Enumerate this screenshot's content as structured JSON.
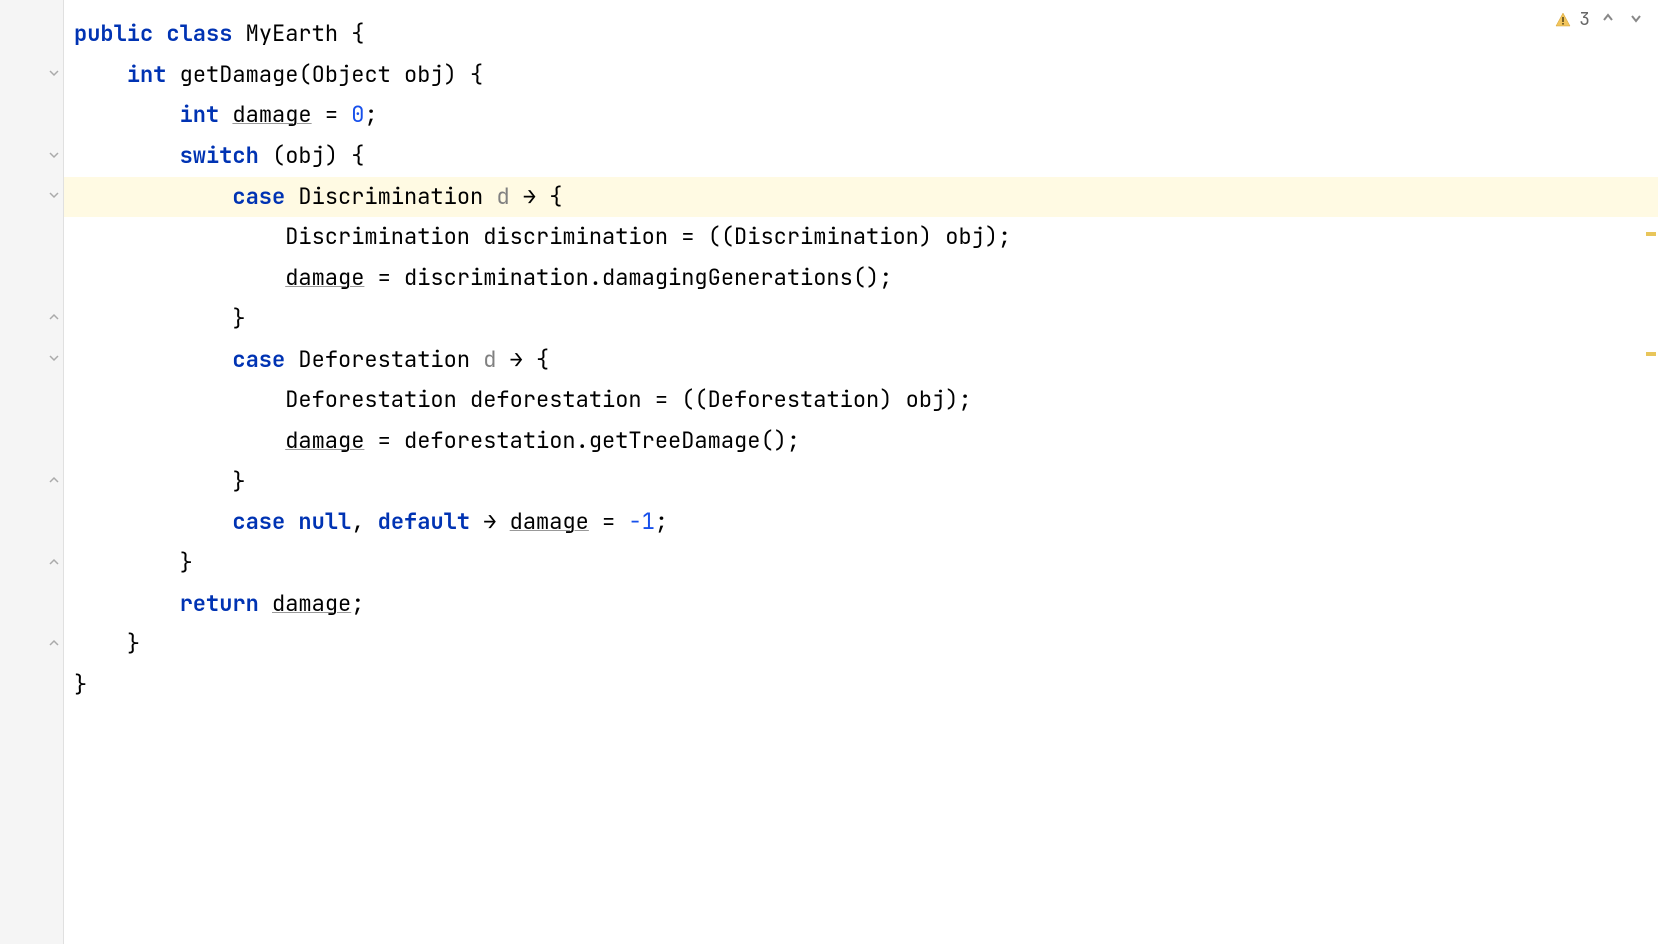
{
  "inspection": {
    "warning_count": "3"
  },
  "code": {
    "line1": {
      "kw_public": "public",
      "kw_class": "class",
      "classname": "MyEarth",
      "brace": " {"
    },
    "line2": {
      "kw_int": "int",
      "method": "getDamage",
      "param_type": "Object",
      "param_name": "obj",
      "brace": ") {"
    },
    "line3": {
      "kw_int": "int",
      "var": "damage",
      "eq": " = ",
      "val": "0",
      "semi": ";"
    },
    "line4": {
      "kw_switch": "switch",
      "expr": " (obj) {"
    },
    "line5": {
      "kw_case": "case",
      "type": "Discrimination",
      "pvar": "d",
      "arrow": " → {"
    },
    "line6": {
      "type": "Discrimination",
      "var": "discrimination",
      "eq": " = ((",
      "cast": "Discrimination",
      "rest": ") obj);"
    },
    "line7": {
      "var": "damage",
      "eq": " = ",
      "obj": "discrimination",
      "dot": ".",
      "method": "damagingGenerations",
      "rest": "();"
    },
    "line8": {
      "brace": "}"
    },
    "line9": {
      "kw_case": "case",
      "type": "Deforestation",
      "pvar": "d",
      "arrow": " → {"
    },
    "line10": {
      "type": "Deforestation",
      "var": "deforestation",
      "eq": " = ((",
      "cast": "Deforestation",
      "rest": ") obj);"
    },
    "line11": {
      "var": "damage",
      "eq": " = ",
      "obj": "deforestation",
      "dot": ".",
      "method": "getTreeDamage",
      "rest": "();"
    },
    "line12": {
      "brace": "}"
    },
    "line13": {
      "kw_case": "case",
      "kw_null": "null",
      "comma": ", ",
      "kw_default": "default",
      "arrow": " → ",
      "var": "damage",
      "eq": " = ",
      "val": "-1",
      "semi": ";"
    },
    "line14": {
      "brace": "}"
    },
    "line15": {
      "kw_return": "return",
      "var": "damage",
      "semi": ";"
    },
    "line16": {
      "brace": "}"
    },
    "line17": {
      "brace": "}"
    }
  }
}
